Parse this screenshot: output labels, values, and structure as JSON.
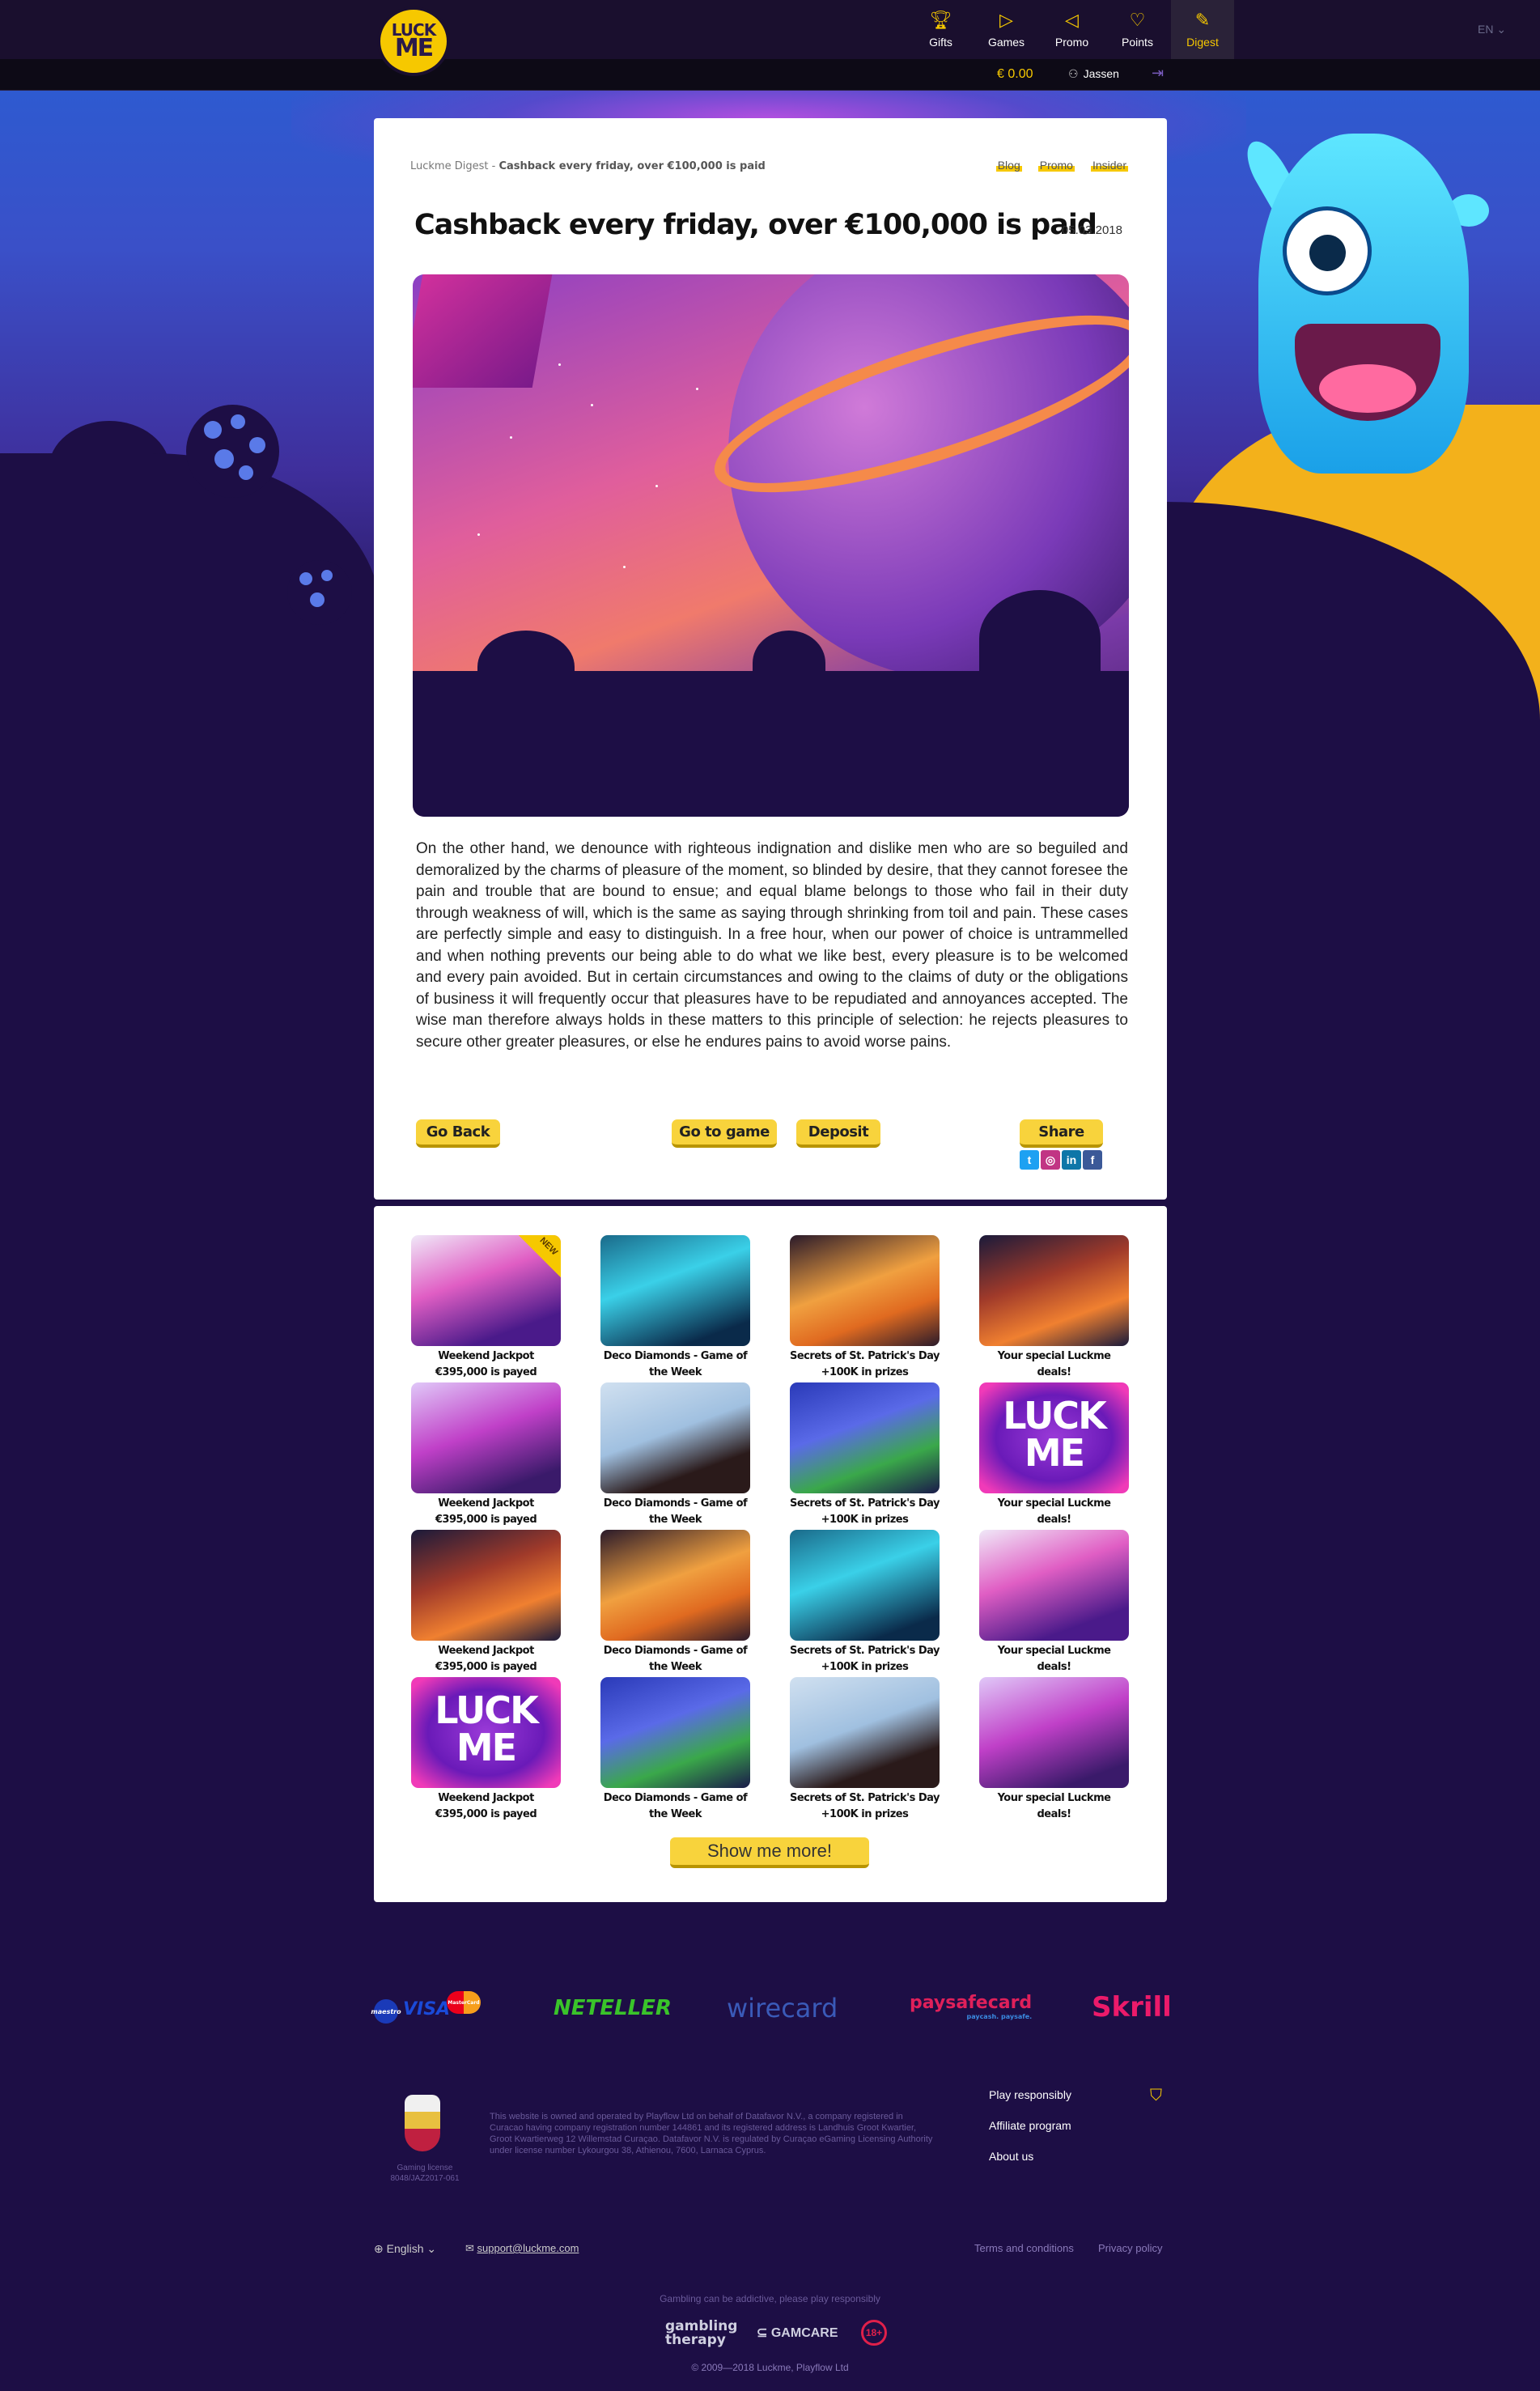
{
  "header": {
    "logo_top": "LUCK",
    "logo_bottom": "ME",
    "nav": [
      {
        "label": "Gifts",
        "icon": "trophy-icon"
      },
      {
        "label": "Games",
        "icon": "play-icon"
      },
      {
        "label": "Promo",
        "icon": "megaphone-icon"
      },
      {
        "label": "Points",
        "icon": "heart-icon"
      },
      {
        "label": "Digest",
        "icon": "pen-icon",
        "active": true
      }
    ],
    "language": "EN ⌄",
    "balance": "€ 0.00",
    "username": "Jassen"
  },
  "article": {
    "breadcrumb_root": "Luckme Digest",
    "breadcrumb_sep": " - ",
    "breadcrumb_current": "Cashback every friday, over €100,000 is paid",
    "tags": [
      "Blog",
      "Promo",
      "Insider"
    ],
    "title": "Cashback every friday, over €100,000 is paid",
    "date": "05.03.2018",
    "body": "On the other hand, we denounce with righteous indignation and dislike men who are so beguiled and demoralized by the charms of pleasure of the moment, so blinded by desire, that they cannot foresee the pain and trouble that are bound to ensue; and equal blame belongs to those who fail in their duty through weakness of will, which is the same as saying through shrinking from toil and pain. These cases are perfectly simple and easy to distinguish. In a free hour, when our power of choice is untrammelled and when nothing prevents our being able to do what we like best, every pleasure is to be welcomed and every pain avoided. But in certain circumstances and owing to the claims of duty or the obligations of business it will frequently occur that pleasures have to be repudiated and annoyances accepted. The wise man therefore always holds in these matters to this principle of selection: he rejects pleasures to secure other greater pleasures, or else he endures pains to avoid worse pains.",
    "buttons": {
      "go_back": "Go Back",
      "go_to_game": "Go to game",
      "deposit": "Deposit",
      "share": "Share"
    },
    "socials": [
      {
        "name": "twitter-icon",
        "color": "#1da1f2",
        "glyph": "t"
      },
      {
        "name": "instagram-icon",
        "color": "#c13584",
        "glyph": "◎"
      },
      {
        "name": "linkedin-icon",
        "color": "#0e76a8",
        "glyph": "in"
      },
      {
        "name": "facebook-icon",
        "color": "#3b5998",
        "glyph": "f"
      }
    ]
  },
  "grid": {
    "items": [
      {
        "caption": "Weekend Jackpot €395,000 is payed",
        "theme": "duck",
        "new": true
      },
      {
        "caption": "Deco Diamonds - Game of the Week",
        "theme": "alien"
      },
      {
        "caption": "Secrets of St. Patrick's Day +100K in prizes",
        "theme": "cat"
      },
      {
        "caption": "Your special Luckme deals!",
        "theme": "robot"
      },
      {
        "caption": "Weekend Jackpot €395,000 is payed",
        "theme": "duck2"
      },
      {
        "caption": "Deco Diamonds - Game of the Week",
        "theme": "paper"
      },
      {
        "caption": "Secrets of St. Patrick's Day +100K in prizes",
        "theme": "ship"
      },
      {
        "caption": "Your special Luckme deals!",
        "theme": "logo"
      },
      {
        "caption": "Weekend Jackpot €395,000 is payed",
        "theme": "robot"
      },
      {
        "caption": "Deco Diamonds - Game of the Week",
        "theme": "cat"
      },
      {
        "caption": "Secrets of St. Patrick's Day +100K in prizes",
        "theme": "alien"
      },
      {
        "caption": "Your special Luckme deals!",
        "theme": "duck"
      },
      {
        "caption": "Weekend Jackpot €395,000 is payed",
        "theme": "logo"
      },
      {
        "caption": "Deco Diamonds - Game of the Week",
        "theme": "ship"
      },
      {
        "caption": "Secrets of St. Patrick's Day +100K in prizes",
        "theme": "paper"
      },
      {
        "caption": "Your special Luckme deals!",
        "theme": "duck2"
      }
    ],
    "new_badge": "NEW",
    "logo_text_top": "LUCK",
    "logo_text_bottom": "ME",
    "show_more": "Show me more!"
  },
  "payments": {
    "maestro": "maestro",
    "visa": "VISA",
    "mastercard": "MasterCard",
    "neteller": "NETELLER",
    "wirecard": "wirecard",
    "paysafe": "paysafecard",
    "paysafe_sub": "paycash. paysafe.",
    "skrill": "Skrill"
  },
  "footer": {
    "legal": "This website is owned and operated by Playflow Ltd on behalf of Datafavor N.V., a company registered in Curacao having company registration number 144861 and its registered address is Landhuis Groot Kwartier, Groot Kwartierweg 12 Willemstad Curaçao. Datafavor N.V. is regulated by Curaçao eGaming Licensing Authority under license number Lykourgou 38, Athienou, 7600, Larnaca Cyprus.",
    "license": "Gaming license 8048/JAZ2017-061",
    "links": [
      "Play responsibly",
      "Affiliate program",
      "About us"
    ],
    "language": "English ⌄",
    "support_email": "support@luckme.com",
    "terms": "Terms and conditions",
    "privacy": "Privacy policy",
    "warning": "Gambling can be addictive, please play responsibly",
    "gambling_therapy_1": "gambling",
    "gambling_therapy_2": "therapy",
    "gamcare": "GAMCARE",
    "age": "18+",
    "copyright": "© 2009—2018 Luckme, Playflow Ltd"
  }
}
